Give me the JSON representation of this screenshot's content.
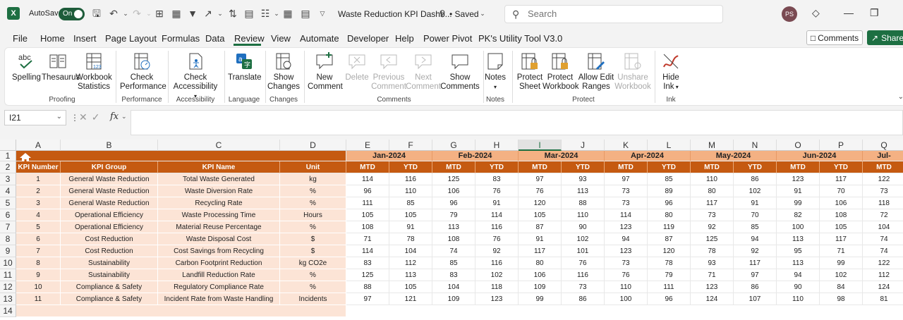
{
  "titlebar": {
    "autosave_label": "AutoSave",
    "autosave_state": "On",
    "doc_title": "Waste Reduction KPI Dashb...",
    "saved_status": "• Saved",
    "search_placeholder": "Search",
    "avatar_initials": "PS"
  },
  "menu": {
    "tabs": [
      "File",
      "Home",
      "Insert",
      "Page Layout",
      "Formulas",
      "Data",
      "Review",
      "View",
      "Automate",
      "Developer",
      "Help",
      "Power Pivot",
      "PK's Utility Tool V3.0"
    ],
    "active": "Review",
    "comments_label": "Comments",
    "share_label": "Share"
  },
  "ribbon": {
    "buttons": {
      "spelling": "Spelling",
      "thesaurus": "Thesaurus",
      "workbook_statistics_1": "Workbook",
      "workbook_statistics_2": "Statistics",
      "check_performance_1": "Check",
      "check_performance_2": "Performance",
      "check_accessibility_1": "Check",
      "check_accessibility_2": "Accessibility",
      "translate": "Translate",
      "show_changes_1": "Show",
      "show_changes_2": "Changes",
      "new_comment_1": "New",
      "new_comment_2": "Comment",
      "delete": "Delete",
      "previous_comment_1": "Previous",
      "previous_comment_2": "Comment",
      "next_comment_1": "Next",
      "next_comment_2": "Comment",
      "show_comments_1": "Show",
      "show_comments_2": "Comments",
      "notes": "Notes",
      "protect_sheet_1": "Protect",
      "protect_sheet_2": "Sheet",
      "protect_workbook_1": "Protect",
      "protect_workbook_2": "Workbook",
      "allow_edit_ranges_1": "Allow Edit",
      "allow_edit_ranges_2": "Ranges",
      "unshare_workbook_1": "Unshare",
      "unshare_workbook_2": "Workbook",
      "hide_ink_1": "Hide",
      "hide_ink_2": "Ink"
    },
    "groups": {
      "proofing": "Proofing",
      "performance": "Performance",
      "accessibility": "Accessibility",
      "language": "Language",
      "changes": "Changes",
      "comments": "Comments",
      "notes": "Notes",
      "protect": "Protect",
      "ink": "Ink"
    }
  },
  "formula_bar": {
    "name_box": "I21",
    "fx_label": "fx",
    "formula": ""
  },
  "sheet": {
    "columns": [
      "A",
      "B",
      "C",
      "D",
      "E",
      "F",
      "G",
      "H",
      "I",
      "J",
      "K",
      "L",
      "M",
      "N",
      "O",
      "P",
      "Q"
    ],
    "selected_column": "I",
    "row_numbers": [
      "1",
      "2",
      "3",
      "4",
      "5",
      "6",
      "7",
      "8",
      "9",
      "10",
      "11",
      "12",
      "13",
      "14"
    ],
    "headers": [
      "KPI Number",
      "KPI Group",
      "KPI Name",
      "Unit"
    ],
    "months": [
      "Jan-2024",
      "Feb-2024",
      "Mar-2024",
      "Apr-2024",
      "May-2024",
      "Jun-2024",
      "Jul-"
    ],
    "sub_headers": [
      "MTD",
      "YTD",
      "MTD",
      "YTD",
      "MTD",
      "YTD",
      "MTD",
      "YTD",
      "MTD",
      "YTD",
      "MTD",
      "YTD",
      "MTD"
    ],
    "rows": [
      {
        "num": "1",
        "group": "General Waste Reduction",
        "name": "Total Waste Generated",
        "unit": "kg",
        "values": [
          "114",
          "116",
          "125",
          "83",
          "97",
          "93",
          "97",
          "85",
          "110",
          "86",
          "123",
          "117",
          "122"
        ]
      },
      {
        "num": "2",
        "group": "General Waste Reduction",
        "name": "Waste Diversion Rate",
        "unit": "%",
        "values": [
          "96",
          "110",
          "106",
          "76",
          "76",
          "113",
          "73",
          "89",
          "80",
          "102",
          "91",
          "70",
          "73"
        ]
      },
      {
        "num": "3",
        "group": "General Waste Reduction",
        "name": "Recycling Rate",
        "unit": "%",
        "values": [
          "111",
          "85",
          "96",
          "91",
          "120",
          "88",
          "73",
          "96",
          "117",
          "91",
          "99",
          "106",
          "118"
        ]
      },
      {
        "num": "4",
        "group": "Operational Efficiency",
        "name": "Waste Processing Time",
        "unit": "Hours",
        "values": [
          "105",
          "105",
          "79",
          "114",
          "105",
          "110",
          "114",
          "80",
          "73",
          "70",
          "82",
          "108",
          "72"
        ]
      },
      {
        "num": "5",
        "group": "Operational Efficiency",
        "name": "Material Reuse Percentage",
        "unit": "%",
        "values": [
          "108",
          "91",
          "113",
          "116",
          "87",
          "90",
          "123",
          "119",
          "92",
          "85",
          "100",
          "105",
          "104"
        ]
      },
      {
        "num": "6",
        "group": "Cost Reduction",
        "name": "Waste Disposal Cost",
        "unit": "$",
        "values": [
          "71",
          "78",
          "108",
          "76",
          "91",
          "102",
          "94",
          "87",
          "125",
          "94",
          "113",
          "117",
          "74"
        ]
      },
      {
        "num": "7",
        "group": "Cost Reduction",
        "name": "Cost Savings from Recycling",
        "unit": "$",
        "values": [
          "114",
          "104",
          "74",
          "92",
          "117",
          "101",
          "123",
          "120",
          "78",
          "92",
          "95",
          "71",
          "74"
        ]
      },
      {
        "num": "8",
        "group": "Sustainability",
        "name": "Carbon Footprint Reduction",
        "unit": "kg CO2e",
        "values": [
          "83",
          "112",
          "85",
          "116",
          "80",
          "76",
          "73",
          "78",
          "93",
          "117",
          "113",
          "99",
          "122"
        ]
      },
      {
        "num": "9",
        "group": "Sustainability",
        "name": "Landfill Reduction Rate",
        "unit": "%",
        "values": [
          "125",
          "113",
          "83",
          "102",
          "106",
          "116",
          "76",
          "79",
          "71",
          "97",
          "94",
          "102",
          "112"
        ]
      },
      {
        "num": "10",
        "group": "Compliance & Safety",
        "name": "Regulatory Compliance Rate",
        "unit": "%",
        "values": [
          "88",
          "105",
          "104",
          "118",
          "109",
          "73",
          "110",
          "111",
          "123",
          "86",
          "90",
          "84",
          "124"
        ]
      },
      {
        "num": "11",
        "group": "Compliance & Safety",
        "name": "Incident Rate from Waste Handling",
        "unit": "Incidents",
        "values": [
          "97",
          "121",
          "109",
          "123",
          "99",
          "86",
          "100",
          "96",
          "124",
          "107",
          "110",
          "98",
          "81"
        ]
      }
    ]
  }
}
